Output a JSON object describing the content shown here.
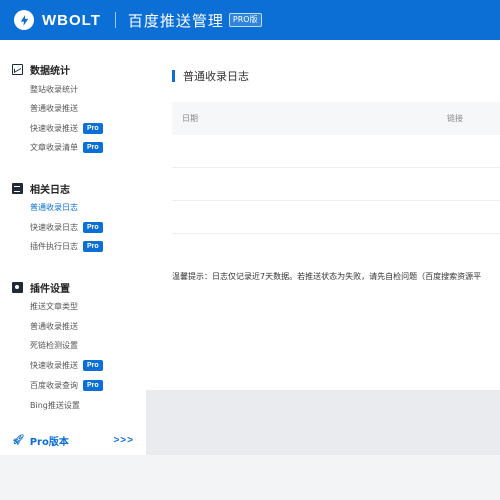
{
  "header": {
    "brand": "WBOLT",
    "title": "百度推送管理",
    "pro_tag": "PRO版",
    "bg_color": "#0b6fd6"
  },
  "sidebar": {
    "groups": [
      {
        "title": "数据统计",
        "icon": "chart-icon",
        "items": [
          {
            "label": "整站收录统计"
          },
          {
            "label": "普通收录推送"
          },
          {
            "label": "快速收录推送",
            "badge": "Pro"
          },
          {
            "label": "文章收录清单",
            "badge": "Pro"
          }
        ]
      },
      {
        "title": "相关日志",
        "icon": "log-icon",
        "items": [
          {
            "label": "普通收录日志",
            "active": true
          },
          {
            "label": "快速收录日志",
            "badge": "Pro"
          },
          {
            "label": "插件执行日志",
            "badge": "Pro"
          }
        ]
      },
      {
        "title": "插件设置",
        "icon": "settings-icon",
        "items": [
          {
            "label": "推送文章类型"
          },
          {
            "label": "普通收录推送"
          },
          {
            "label": "死链检测设置"
          },
          {
            "label": "快速收录推送",
            "badge": "Pro"
          },
          {
            "label": "百度收录查询",
            "badge": "Pro"
          },
          {
            "label": "Bing推送设置"
          }
        ]
      }
    ],
    "pro_version": {
      "label": "Pro版本",
      "arrows": ">>>"
    }
  },
  "main": {
    "section_title": "普通收录日志",
    "table": {
      "columns": [
        "日期",
        "链接"
      ]
    },
    "hint": "温馨提示：日志仅记录近7天数据。若推送状态为失败，请先自检问题（百度搜索资源平"
  }
}
